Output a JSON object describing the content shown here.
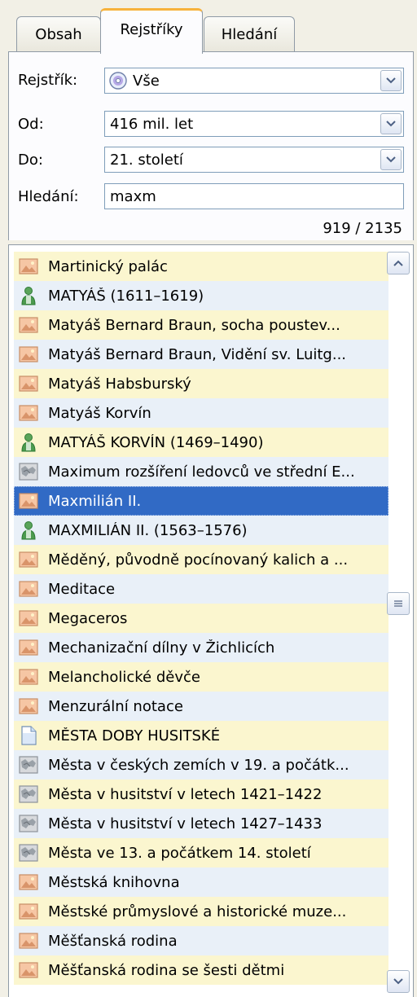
{
  "tabs": [
    "Obsah",
    "Rejstříky",
    "Hledání"
  ],
  "filters": {
    "rejstrik_label": "Rejstřík:",
    "rejstrik_value": "Vše",
    "od_label": "Od:",
    "od_value": "416 mil. let",
    "do_label": "Do:",
    "do_value": "21. století",
    "hledani_label": "Hledání:",
    "hledani_value": "maxm"
  },
  "count": "919 / 2135",
  "items": [
    {
      "text": "Martinický palác",
      "icon": "image-icon"
    },
    {
      "text": "MATYÁŠ (1611–1619)",
      "icon": "person-icon"
    },
    {
      "text": "Matyáš Bernard Braun, socha poustev...",
      "icon": "image-icon"
    },
    {
      "text": "Matyáš Bernard Braun, Vidění sv. Luitg...",
      "icon": "image-icon"
    },
    {
      "text": "Matyáš Habsburský",
      "icon": "image-icon"
    },
    {
      "text": "Matyáš Korvín",
      "icon": "image-icon"
    },
    {
      "text": "MATYÁŠ KORVÍN (1469–1490)",
      "icon": "person-icon"
    },
    {
      "text": "Maximum rozšíření ledovců ve střední E...",
      "icon": "map-icon"
    },
    {
      "text": "Maxmilián II.",
      "icon": "image-icon",
      "selected": true
    },
    {
      "text": "MAXMILIÁN II. (1563–1576)",
      "icon": "person-icon"
    },
    {
      "text": "Měděný, původně pocínovaný kalich a ...",
      "icon": "image-icon"
    },
    {
      "text": "Meditace",
      "icon": "image-icon"
    },
    {
      "text": "Megaceros",
      "icon": "image-icon"
    },
    {
      "text": "Mechanizační dílny v Žichlicích",
      "icon": "image-icon"
    },
    {
      "text": "Melancholické děvče",
      "icon": "image-icon"
    },
    {
      "text": "Menzurální notace",
      "icon": "image-icon"
    },
    {
      "text": "MĚSTA DOBY HUSITSKÉ",
      "icon": "document-icon"
    },
    {
      "text": "Města v českých zemích v 19. a počátk...",
      "icon": "map-icon"
    },
    {
      "text": "Města v husitství v letech 1421–1422",
      "icon": "map-icon"
    },
    {
      "text": "Města v husitství v letech 1427–1433",
      "icon": "map-icon"
    },
    {
      "text": "Města ve 13. a počátkem 14. století",
      "icon": "map-icon"
    },
    {
      "text": "Městská knihovna",
      "icon": "image-icon"
    },
    {
      "text": "Městské průmyslové a historické muze...",
      "icon": "image-icon"
    },
    {
      "text": "Měšťanská rodina",
      "icon": "image-icon"
    },
    {
      "text": "Měšťanská rodina se šesti dětmi",
      "icon": "image-icon"
    }
  ],
  "colors": {
    "row_alt_yellow": "#fbf6cf",
    "row_alt_blue": "#e9f0f8",
    "selection": "#316ac5",
    "active_tab_accent": "#f7b23c"
  }
}
